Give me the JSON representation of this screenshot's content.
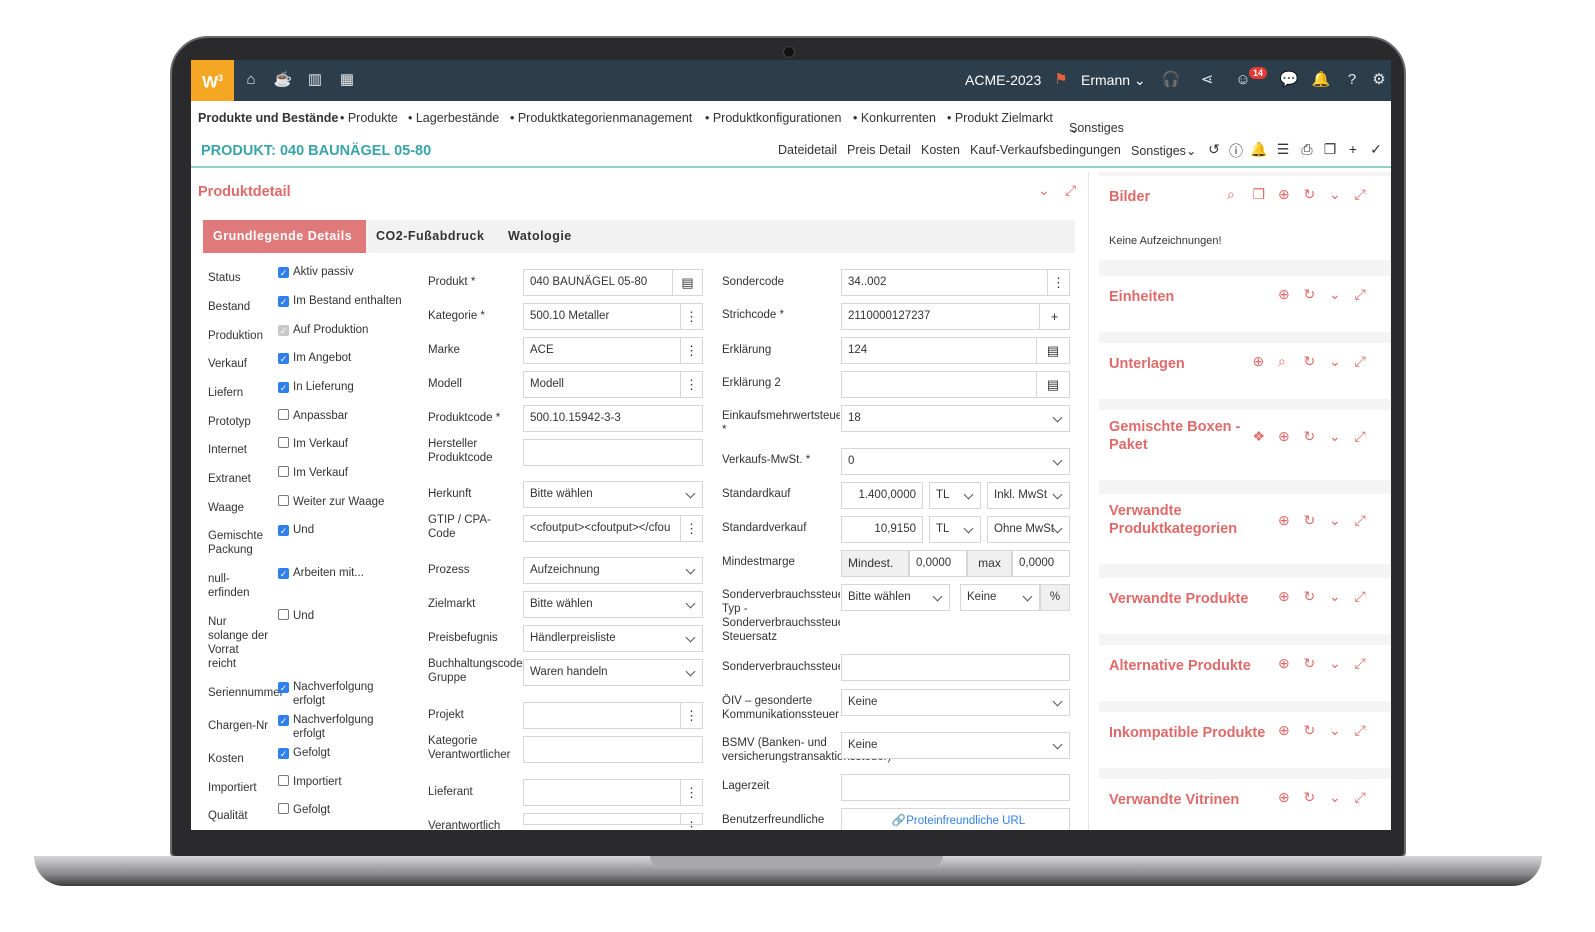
{
  "topbar": {
    "logo": "W",
    "logo_sup": "3",
    "company": "ACME-2023",
    "user": "Ermann",
    "notification_count": "14"
  },
  "nav": {
    "module": "Produkte und Bestände",
    "items": [
      "• Produkte",
      "• Lagerbestände",
      "• Produktkategorienmanagement",
      "• Produktkonfigurationen",
      "• Konkurrenten",
      "• Produkt Zielmarkt",
      "Sonstiges"
    ]
  },
  "titlebar": {
    "title": "PRODUKT: 040 BAUNÄGEL 05-80",
    "links": [
      "Dateidetail",
      "Preis Detail",
      "Kosten",
      "Kauf-Verkaufsbedingungen",
      "Sonstiges"
    ]
  },
  "main": {
    "title": "Produktdetail",
    "tabs": [
      "Grundlegende Details",
      "CO2-Fußabdruck",
      "Watologie"
    ],
    "flags": [
      {
        "label": "Status",
        "check": "Aktiv passiv",
        "state": "on"
      },
      {
        "label": "Bestand",
        "check": "Im Bestand enthalten",
        "state": "on"
      },
      {
        "label": "Produktion",
        "check": "Auf Produktion",
        "state": "grey"
      },
      {
        "label": "Verkauf",
        "check": "Im Angebot",
        "state": "on"
      },
      {
        "label": "Liefern",
        "check": "In Lieferung",
        "state": "on"
      },
      {
        "label": "Prototyp",
        "check": "Anpassbar",
        "state": "off"
      },
      {
        "label": "Internet",
        "check": "Im Verkauf",
        "state": "off"
      },
      {
        "label": "Extranet",
        "check": "Im Verkauf",
        "state": "off"
      },
      {
        "label": "Waage",
        "check": "Weiter zur Waage",
        "state": "off"
      },
      {
        "label": "Gemischte\nPackung",
        "check": "Und",
        "state": "on"
      },
      {
        "label": "null-\nerfinden",
        "check": "Arbeiten mit...",
        "state": "on"
      },
      {
        "label": "Nur\nsolange der\nVorrat\nreicht",
        "check": "Und",
        "state": "off"
      },
      {
        "label": "Seriennummer",
        "check": "Nachverfolgung\nerfolgt",
        "state": "on"
      },
      {
        "label": "Chargen-Nr",
        "check": "Nachverfolgung\nerfolgt",
        "state": "on"
      },
      {
        "label": "Kosten",
        "check": "Gefolgt",
        "state": "on"
      },
      {
        "label": "Importiert",
        "check": "Importiert",
        "state": "off"
      },
      {
        "label": "Qualität",
        "check": "Gefolgt",
        "state": "off"
      }
    ],
    "col2": [
      {
        "label": "Produkt *",
        "value": "040 BAUNÄGEL 05-80",
        "kind": "book"
      },
      {
        "label": "Kategorie *",
        "value": "500.10 Metaller",
        "kind": "dots"
      },
      {
        "label": "Marke",
        "value": "ACE",
        "kind": "dots"
      },
      {
        "label": "Modell",
        "value": "Modell",
        "kind": "dots"
      },
      {
        "label": "Produktcode *",
        "value": "500.10.15942-3-3",
        "kind": "text"
      },
      {
        "label": "Hersteller\nProduktcode",
        "value": "",
        "kind": "text"
      },
      {
        "label": "Herkunft",
        "value": "Bitte wählen",
        "kind": "select"
      },
      {
        "label": "GTIP / CPA-\nCode",
        "value": "<cfoutput><cfoutput></cfou",
        "kind": "dots"
      },
      {
        "label": "Prozess",
        "value": "Aufzeichnung",
        "kind": "select"
      },
      {
        "label": "Zielmarkt",
        "value": "Bitte wählen",
        "kind": "select"
      },
      {
        "label": "Preisbefugnis",
        "value": "Händlerpreisliste",
        "kind": "select"
      },
      {
        "label": "Buchhaltungscode\nGruppe",
        "value": "Waren handeln",
        "kind": "select"
      },
      {
        "label": "Projekt",
        "value": "",
        "kind": "dots"
      },
      {
        "label": "Kategorie\nVerantwortlicher",
        "value": "",
        "kind": "text"
      },
      {
        "label": "Lieferant",
        "value": "",
        "kind": "dots"
      },
      {
        "label": "Verantwortlich",
        "value": "",
        "kind": "dots"
      }
    ],
    "col3": {
      "sondercode_label": "Sondercode",
      "sondercode": "34..002",
      "strichcode_label": "Strichcode *",
      "strichcode": "2110000127237",
      "erklaerung_label": "Erklärung",
      "erklaerung": "124",
      "erklaerung2_label": "Erklärung 2",
      "erklaerung2": "",
      "einkauf_mwst_label": "Einkaufsmehrwertsteuer\n*",
      "einkauf_mwst": "18",
      "verkauf_mwst_label": "Verkaufs-MwSt. *",
      "verkauf_mwst": "0",
      "standardkauf_label": "Standardkauf",
      "standardkauf": "1.400,0000",
      "standardkauf_cur": "TL",
      "standardkauf_tax": "Inkl. MwSt",
      "standardverkauf_label": "Standardverkauf",
      "standardverkauf": "10,9150",
      "standardverkauf_cur": "TL",
      "standardverkauf_tax": "Ohne MwSt",
      "mindestmarge_label": "Mindestmarge",
      "mindest_prefix": "Mindest.",
      "mindest_value": "0,0000",
      "max_prefix": "max",
      "max_value": "0,0000",
      "sonder_typ_label": "Sonderverbrauchssteuer\nTyp -\nSonderverbrauchssteuer\nSteuersatz",
      "sonder_typ": "Bitte wählen",
      "sonder_satz": "Keine",
      "percent": "%",
      "sonder_label": "Sonderverbrauchssteuer",
      "sonder": "",
      "oiv_label": "ÖIV – gesonderte\nKommunikationssteuer",
      "oiv": "Keine",
      "bsmv_label": "BSMV (Banken- und\nversicherungstransaktionssteuer)",
      "bsmv": "Keine",
      "lagerzeit_label": "Lagerzeit",
      "lagerzeit": "",
      "url_label": "Benutzerfreundliche",
      "url_link": "Proteinfreundliche URL"
    }
  },
  "side": {
    "cards": [
      {
        "title": "Bilder",
        "body": "Keine Aufzeichnungen!"
      },
      {
        "title": "Einheiten"
      },
      {
        "title": "Unterlagen"
      },
      {
        "title": "Gemischte Boxen -\nPaket"
      },
      {
        "title": "Verwandte\nProduktkategorien"
      },
      {
        "title": "Verwandte Produkte"
      },
      {
        "title": "Alternative Produkte"
      },
      {
        "title": "Inkompatible Produkte"
      },
      {
        "title": "Verwandte Vitrinen"
      }
    ]
  },
  "colors": {
    "accent": "#e06a6a",
    "title_teal": "#3aa4a8",
    "topbar": "#2c3e4c",
    "logo": "#f5a623",
    "check": "#2f80ed"
  }
}
